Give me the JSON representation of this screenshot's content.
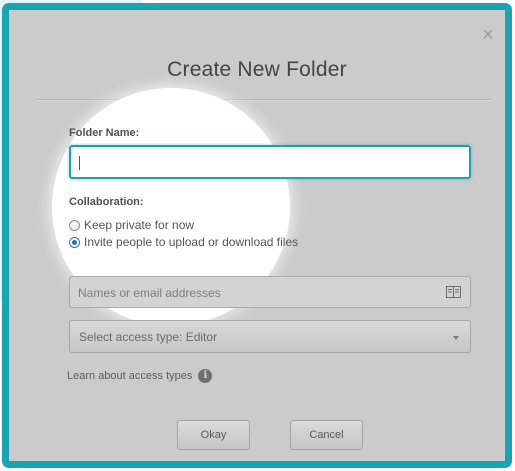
{
  "dialog": {
    "title": "Create New Folder",
    "close_symbol": "×"
  },
  "folder_name": {
    "label": "Folder Name:",
    "value": ""
  },
  "collaboration": {
    "label": "Collaboration:",
    "options": [
      {
        "label": "Keep private for now",
        "checked": false
      },
      {
        "label": "Invite people to upload or download files",
        "checked": true
      }
    ]
  },
  "invite": {
    "emails_placeholder": "Names or email addresses",
    "access_select_value": "Select access type: Editor",
    "learn_link": "Learn about access types",
    "info_symbol": "i"
  },
  "buttons": {
    "okay": "Okay",
    "cancel": "Cancel"
  },
  "colors": {
    "frame": "#1ba3b1",
    "focus_border": "#1ba3b1",
    "overlay": "#cbcbcb",
    "radio_selected": "#1f6fc0"
  },
  "icons": {
    "close": "close-icon",
    "address_book": "address-book-icon",
    "dropdown": "chevron-down-icon",
    "info": "info-icon"
  }
}
